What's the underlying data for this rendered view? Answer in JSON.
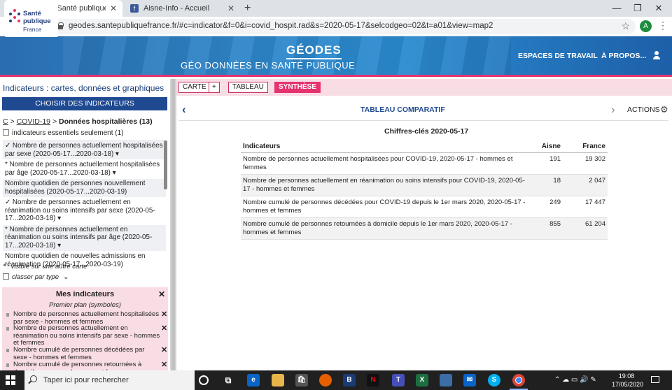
{
  "browser": {
    "tabs": [
      {
        "title": "Géodes - Santé publique France"
      },
      {
        "title": "Aisne-Info - Accueil"
      }
    ],
    "new_tab": "+",
    "url": "geodes.santepubliquefrance.fr/#c=indicator&f=0&i=covid_hospit.rad&s=2020-05-17&selcodgeo=02&t=a01&view=map2",
    "profile_initial": "A"
  },
  "header": {
    "logo": {
      "line1": "Santé",
      "line2": "publique",
      "line3": "France"
    },
    "brand": "GÉODES",
    "subtitle": "GÉO DONNÉES EN SANTÉ PUBLIQUE",
    "nav": [
      "ESPACES DE TRAVAIL",
      "À PROPOS..."
    ],
    "accent": "#e5336f"
  },
  "left": {
    "title": "Indicateurs : cartes, données et graphiques",
    "choose_button": "CHOISIR DES INDICATEURS",
    "crumb": {
      "root": "C",
      "sep": ">",
      "covid": "COVID-19",
      "current": "Données hospitalières (13)"
    },
    "essentials": "indicateurs essentiels seulement (1)",
    "indicators": [
      {
        "text": "✓ Nombre de personnes actuellement hospitalisées par sexe (2020-05-17...2020-03-18) ▾",
        "selected": true
      },
      {
        "text": "* Nombre de personnes actuellement hospitalisées par âge (2020-05-17...2020-03-18) ▾",
        "selected": false
      },
      {
        "text": "Nombre quotidien de personnes nouvellement hospitalisées (2020-05-17...2020-03-19)",
        "selected": true
      },
      {
        "text": "✓ Nombre de personnes actuellement en réanimation ou soins intensifs par sexe (2020-05-17...2020-03-18) ▾",
        "selected": false
      },
      {
        "text": "* Nombre de personnes actuellement en réanimation ou soins intensifs par âge (2020-05-17...2020-03-18) ▾",
        "selected": true
      },
      {
        "text": "Nombre quotidien de nouvelles admissions en réanimation (2020-05-17...2020-03-19)",
        "selected": false
      }
    ],
    "footnote": "* : visible sur une autre carte",
    "classer": "classer par type",
    "mes_indicateurs": {
      "title": "Mes indicateurs",
      "plan": "Premier plan (symboles)",
      "items": [
        "Nombre de personnes actuellement hospitalisées par sexe - hommes et femmes",
        "Nombre de personnes actuellement en réanimation ou soins intensifs par sexe - hommes et femmes",
        "Nombre cumulé de personnes décédées par sexe - hommes et femmes",
        "Nombre cumulé de personnes retournées à domicile par sexe - hommes et femmes"
      ]
    }
  },
  "modes": {
    "carte": "CARTE",
    "plus": "+",
    "tableau": "TABLEAU",
    "synthese": "SYNTHÈSE"
  },
  "main": {
    "title": "TABLEAU COMPARATIF",
    "actions": "ACTIONS",
    "table_title": "Chiffres-clés 2020-05-17",
    "columns": [
      "Indicateurs",
      "Aisne",
      "France"
    ],
    "rows": [
      {
        "label": "Nombre de personnes actuellement hospitalisées pour COVID-19, 2020-05-17 - hommes et femmes",
        "aisne": "191",
        "france": "19 302"
      },
      {
        "label": "Nombre de personnes actuellement en réanimation ou soins intensifs pour COVID-19, 2020-05-17 - hommes et femmes",
        "aisne": "18",
        "france": "2 047"
      },
      {
        "label": "Nombre cumulé de personnes décédées pour COVID-19 depuis le 1er mars 2020, 2020-05-17 - hommes et femmes",
        "aisne": "249",
        "france": "17 447"
      },
      {
        "label": "Nombre cumulé de personnes retournées à domicile depuis le 1er mars 2020, 2020-05-17 - hommes et femmes",
        "aisne": "855",
        "france": "61 204"
      }
    ]
  },
  "taskbar": {
    "search_placeholder": "Taper ici pour rechercher",
    "apps": [
      "task-view",
      "edge",
      "file-explorer",
      "store",
      "firefox",
      "bitdefender",
      "netflix",
      "teams",
      "excel",
      "photos",
      "mail",
      "skype",
      "chrome"
    ],
    "time": "19:08",
    "date": "17/05/2020"
  }
}
